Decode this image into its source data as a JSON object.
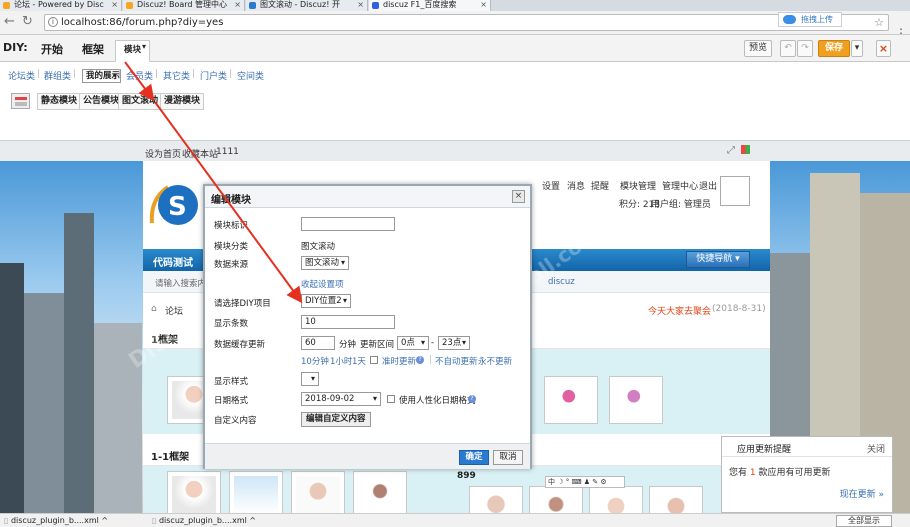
{
  "tabs": [
    {
      "label": "论坛 - Powered by Disc",
      "active": false
    },
    {
      "label": "Discuz! Board 管理中心",
      "active": false
    },
    {
      "label": "图文滚动 - Discuz! 开",
      "active": false
    },
    {
      "label": "discuz F1_百度搜索",
      "active": true
    }
  ],
  "cloud_button": "拖拽上传",
  "address": {
    "url": "localhost:86/forum.php?diy=yes"
  },
  "diy": {
    "label": "DIY:",
    "top_tabs": [
      "开始",
      "框架",
      "模块"
    ],
    "active_tab": "模块",
    "preview": "预览",
    "undo": "↶",
    "redo": "↷",
    "save": "保存",
    "close": "×",
    "categories": [
      "论坛类",
      "群组类",
      "我的展示",
      "会员类",
      "其它类",
      "门户类",
      "空间类"
    ],
    "active_category": "我的展示",
    "modules": [
      "静态模块",
      "公告模块",
      "图文滚动",
      "漫游模块"
    ]
  },
  "strip": {
    "set_home": "设为首页",
    "bookmark": "收藏本站",
    "count": "1111"
  },
  "forum": {
    "top_links": [
      "设置",
      "消息",
      "提醒",
      "模块管理",
      "管理中心",
      "退出"
    ],
    "points": "积分: 213",
    "usergroup": "用户组: 管理员",
    "nav_title": "代码测试",
    "quick_nav": "快捷导航",
    "search_placeholder": "请输入搜索内容",
    "hot_search": "discuz",
    "breadcrumb": "论坛",
    "announcement": "今天大家去聚会",
    "announce_date": "(2018-8-31)",
    "block1_title": "1框架",
    "block2_title": "1-1框架",
    "num_label": "899"
  },
  "dialog": {
    "title": "编辑模块",
    "close": "×",
    "fields": {
      "block_title_label": "模块标识",
      "block_title_value": "",
      "category_label": "模块分类",
      "category_value": "图文滚动",
      "source_label": "数据来源",
      "source_value": "图文滚动",
      "collapse_link": "收起设置项",
      "diy_item_label": "请选择DIY项目",
      "diy_item_value": "DIY位置2",
      "count_label": "显示条数",
      "count_value": "10",
      "cache_label": "数据缓存更新",
      "cache_value": "60",
      "cache_unit": "分钟",
      "range_label": "更新区间",
      "range_start": "0点",
      "range_sep": "-",
      "range_end": "23点",
      "quick_10": "10分钟",
      "quick_1h": "1小时",
      "quick_1d": "1天",
      "timed_update": "准时更新",
      "no_auto": "不自动更新",
      "never": "永不更新",
      "style_label": "显示样式",
      "style_value": "",
      "date_label": "日期格式",
      "date_value": "2018-09-02",
      "humanize_label": "使用人性化日期格式",
      "custom_label": "自定义内容",
      "custom_button": "编辑自定义内容"
    },
    "ok": "确定",
    "cancel": "取消"
  },
  "notice": {
    "title": "应用更新提醒",
    "close": "关闭",
    "msg_prefix": "您有",
    "msg_count": "1",
    "msg_suffix": "款应用有可用更新",
    "more": "现在更新 »"
  },
  "downloads": [
    {
      "name": "discuz_plugin_b....xml"
    },
    {
      "name": "discuz_plugin_b....xml"
    }
  ],
  "show_all": "全部显示",
  "watermarks": [
    "DISCUZ!应用中心",
    "addon.dismall.com"
  ],
  "colors": {
    "accent": "#1364a8",
    "save": "#f0a020",
    "link": "#3a6fb0",
    "arrow": "#e53020"
  }
}
